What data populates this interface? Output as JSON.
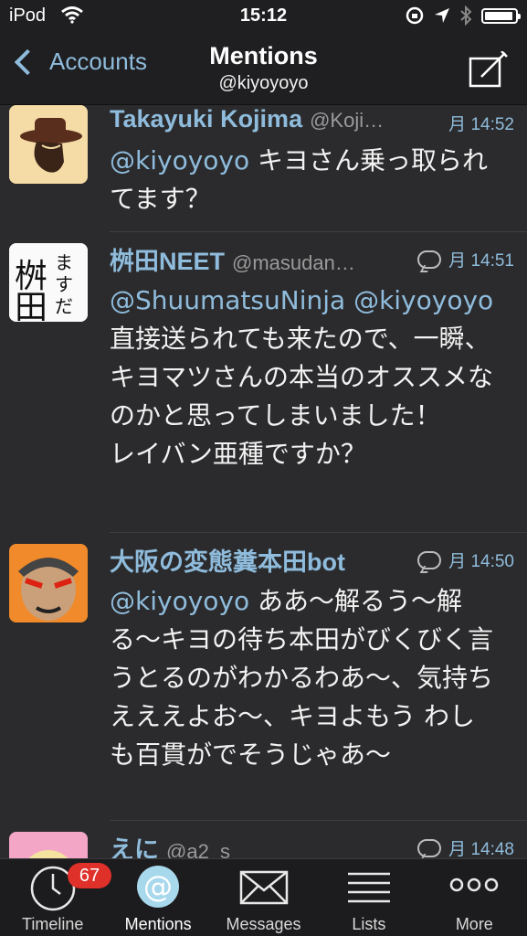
{
  "status_bar": {
    "carrier": "iPod",
    "time": "15:12",
    "battery_level": 0.95
  },
  "nav": {
    "back_label": "Accounts",
    "title": "Mentions",
    "subtitle": "@kiyoyoyo",
    "compose_icon": "compose-icon"
  },
  "tweets": [
    {
      "name": "Takayuki Kojima",
      "screen_name": "@Koji…",
      "time": "月 14:52",
      "has_conversation": false,
      "mention": "@kiyoyoyo",
      "text": " キヨさん乗っ取られてます？"
    },
    {
      "name": "桝田NEET",
      "screen_name": "@masudan…",
      "time": "月 14:51",
      "has_conversation": true,
      "mention": "@ShuumatsuNinja @kiyoyoyo",
      "text": "\n直接送られても来たので、一瞬、キヨマツさんの本当のオススメなのかと思ってしまいました！\nレイバン亜種ですか？"
    },
    {
      "name": "大阪の変態糞本田bot",
      "screen_name": "",
      "time": "月 14:50",
      "has_conversation": true,
      "mention": "@kiyoyoyo",
      "text": " ああ〜解るう〜解る〜キヨの待ち本田がびくびく言うとるのがわかるわあ〜、気持ちえええよお〜、キヨよもう わしも百貫がでそうじゃあ〜"
    },
    {
      "name": "えに",
      "screen_name": "@a2_s",
      "time": "月 14:48",
      "has_conversation": true,
      "mention": "",
      "text": ""
    }
  ],
  "tab_bar": {
    "items": [
      {
        "label": "Timeline",
        "icon": "clock-icon",
        "badge": "67"
      },
      {
        "label": "Mentions",
        "icon": "at-icon",
        "badge": ""
      },
      {
        "label": "Messages",
        "icon": "envelope-icon",
        "badge": ""
      },
      {
        "label": "Lists",
        "icon": "list-icon",
        "badge": ""
      },
      {
        "label": "More",
        "icon": "ellipsis-icon",
        "badge": ""
      }
    ],
    "active_index": 1
  }
}
